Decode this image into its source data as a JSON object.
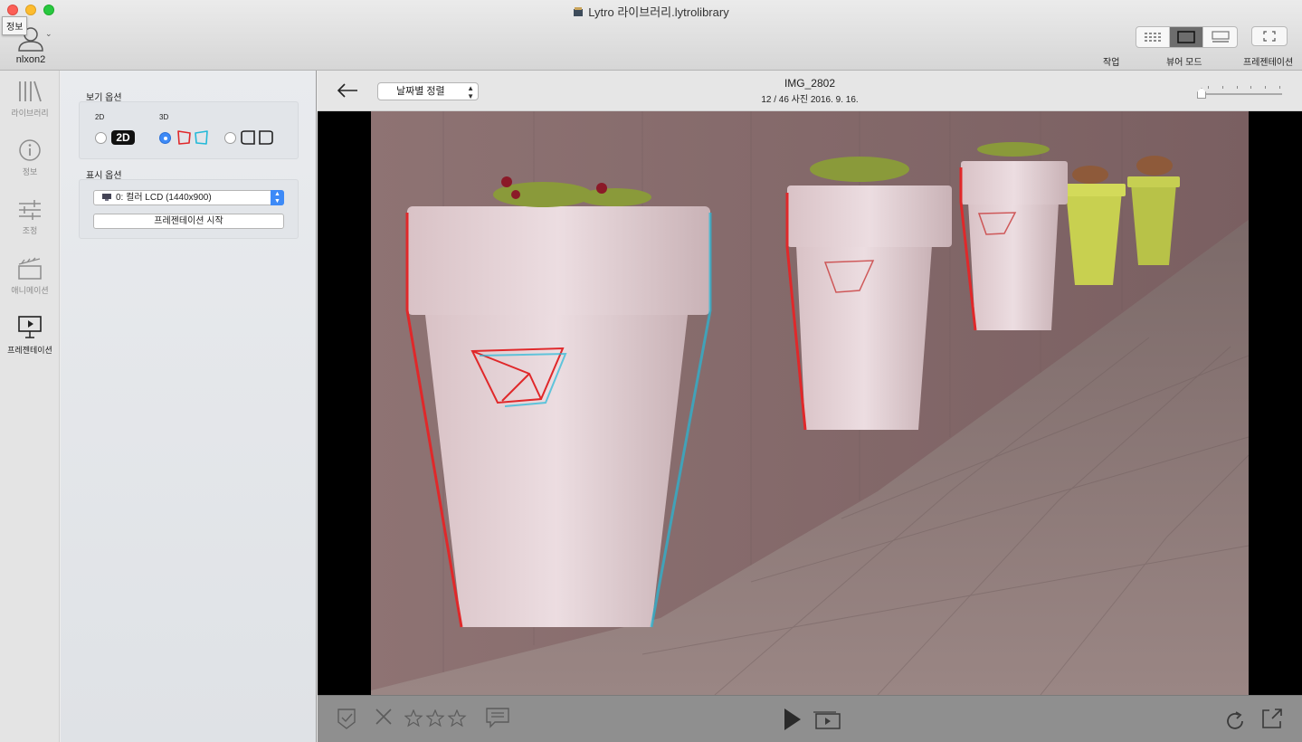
{
  "window": {
    "title": "Lytro 라이브러리.lytrolibrary",
    "tooltip": "정보"
  },
  "user": {
    "name": "nlxon2"
  },
  "toolbar": {
    "modes": [
      {
        "label": "작업",
        "icon": "grid-icon"
      },
      {
        "label": "뷰어 모드",
        "icon": "single-view-icon",
        "active": true
      },
      {
        "label": "",
        "icon": "filmstrip-icon"
      }
    ],
    "presentation_label": "프레젠테이션"
  },
  "rail": {
    "items": [
      {
        "label": "라이브러리",
        "icon": "library-icon"
      },
      {
        "label": "정보",
        "icon": "info-icon"
      },
      {
        "label": "조정",
        "icon": "sliders-icon"
      },
      {
        "label": "애니메이션",
        "icon": "clapper-icon"
      },
      {
        "label": "프레젠테이션",
        "icon": "presentation-icon",
        "active": true
      }
    ]
  },
  "panel": {
    "view_options_title": "보기 옵션",
    "label_2d": "2D",
    "label_3d": "3D",
    "badge_2d": "2D",
    "selected_mode": "3D anaglyph",
    "display_options_title": "표시 옵션",
    "display_select": "0: 컬러 LCD (1440x900)",
    "start_button": "프레젠테이션 시작"
  },
  "viewer": {
    "sort": "날짜별 정렬",
    "image_name": "IMG_2802",
    "image_info": "12 / 46 사진  2016. 9. 16.",
    "zoom_slider": 0.0
  },
  "colors": {
    "accent": "#3d8af7",
    "anaglyph_red": "#e0282a",
    "anaglyph_cyan": "#23b9d8"
  }
}
